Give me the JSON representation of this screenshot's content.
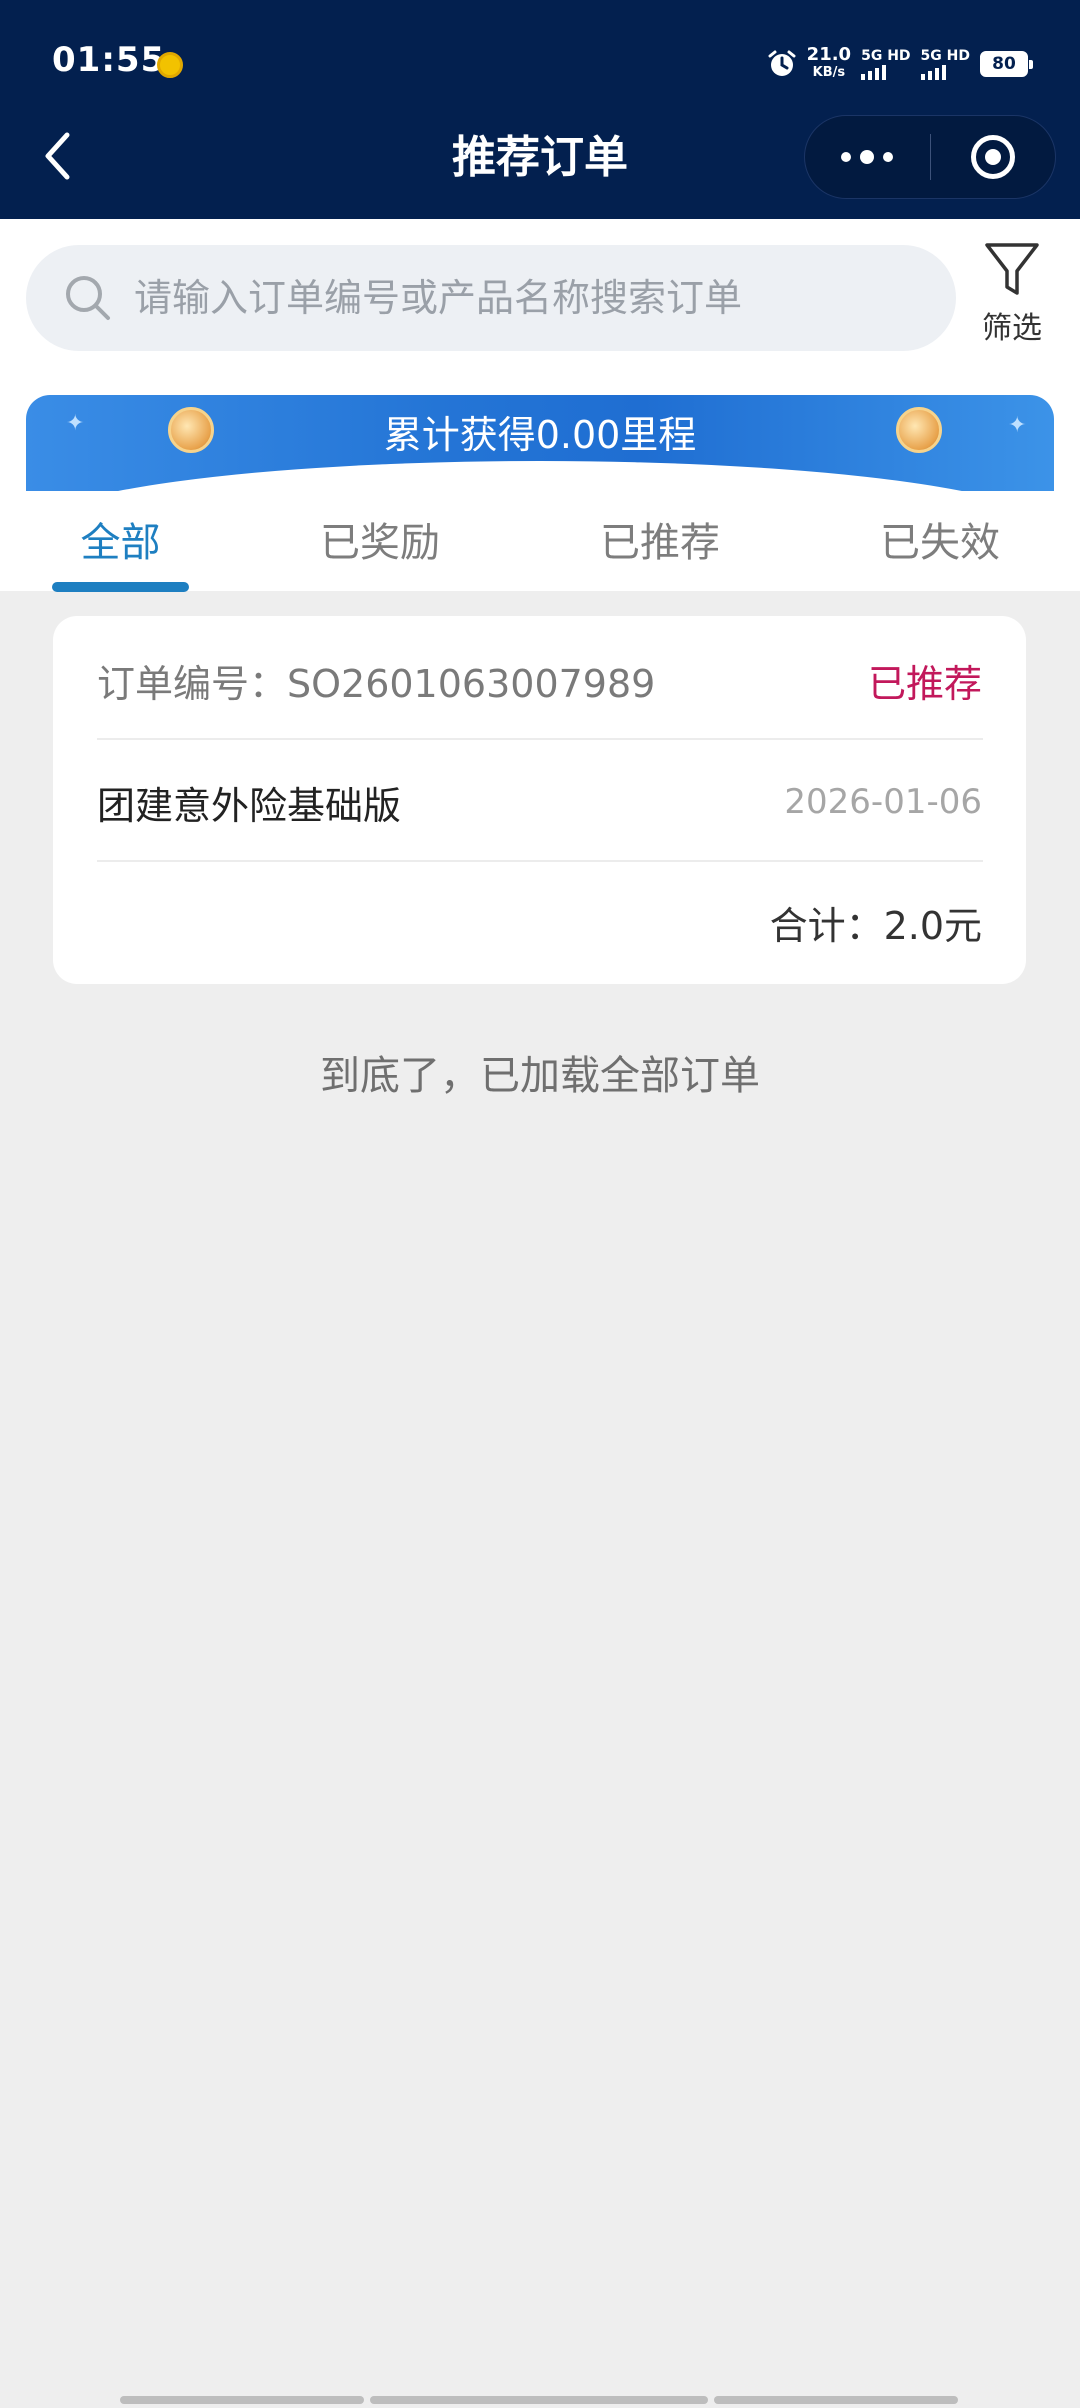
{
  "status_bar": {
    "time": "01:55",
    "net_speed_value": "21.0",
    "net_speed_unit": "KB/s",
    "sim1_label": "5G HD",
    "sim2_label": "5G HD",
    "battery": "80"
  },
  "header": {
    "title": "推荐订单"
  },
  "search": {
    "placeholder": "请输入订单编号或产品名称搜索订单",
    "filter_label": "筛选"
  },
  "banner": {
    "text": "累计获得0.00里程"
  },
  "tabs": [
    {
      "label": "全部",
      "active": true
    },
    {
      "label": "已奖励",
      "active": false
    },
    {
      "label": "已推荐",
      "active": false
    },
    {
      "label": "已失效",
      "active": false
    }
  ],
  "orders": [
    {
      "order_no": "订单编号：SO2601063007989",
      "status": "已推荐",
      "product": "团建意外险基础版",
      "date": "2026-01-06",
      "total": "合计：2.0元"
    }
  ],
  "end_note": "到底了，已加载全部订单",
  "colors": {
    "header_bg": "#03204f",
    "accent": "#1e7fc1",
    "status_recommended": "#c2185b"
  }
}
